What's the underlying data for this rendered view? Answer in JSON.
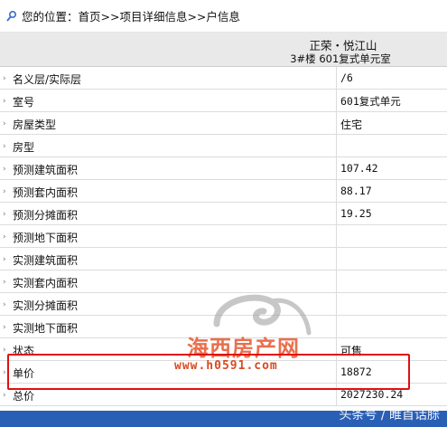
{
  "breadcrumb": {
    "prefix": "您的位置：",
    "path": "首页>>项目详细信息>>户信息"
  },
  "header": {
    "project_name": "正荣・悦江山",
    "unit_name": "3#楼  601复式单元室"
  },
  "rows": [
    {
      "label": "名义层/实际层",
      "value": "/6"
    },
    {
      "label": "室号",
      "value": "601复式单元"
    },
    {
      "label": "房屋类型",
      "value": "住宅"
    },
    {
      "label": "房型",
      "value": ""
    },
    {
      "label": "预测建筑面积",
      "value": "107.42"
    },
    {
      "label": "预测套内面积",
      "value": "88.17"
    },
    {
      "label": "预测分摊面积",
      "value": "19.25"
    },
    {
      "label": "预测地下面积",
      "value": ""
    },
    {
      "label": "实测建筑面积",
      "value": ""
    },
    {
      "label": "实测套内面积",
      "value": ""
    },
    {
      "label": "实测分摊面积",
      "value": ""
    },
    {
      "label": "实测地下面积",
      "value": ""
    },
    {
      "label": "状态",
      "value": "可售"
    },
    {
      "label": "单价",
      "value": "18872"
    },
    {
      "label": "总价",
      "value": "2027230.24"
    }
  ],
  "watermark": {
    "title": "海西房产网",
    "url": "www.h0591.com"
  },
  "footer_caption": "头条号 / 睢首话脎",
  "colors": {
    "highlight": "#e01010",
    "header_bg": "#e9e9e9",
    "watermark": "#e8603a"
  }
}
